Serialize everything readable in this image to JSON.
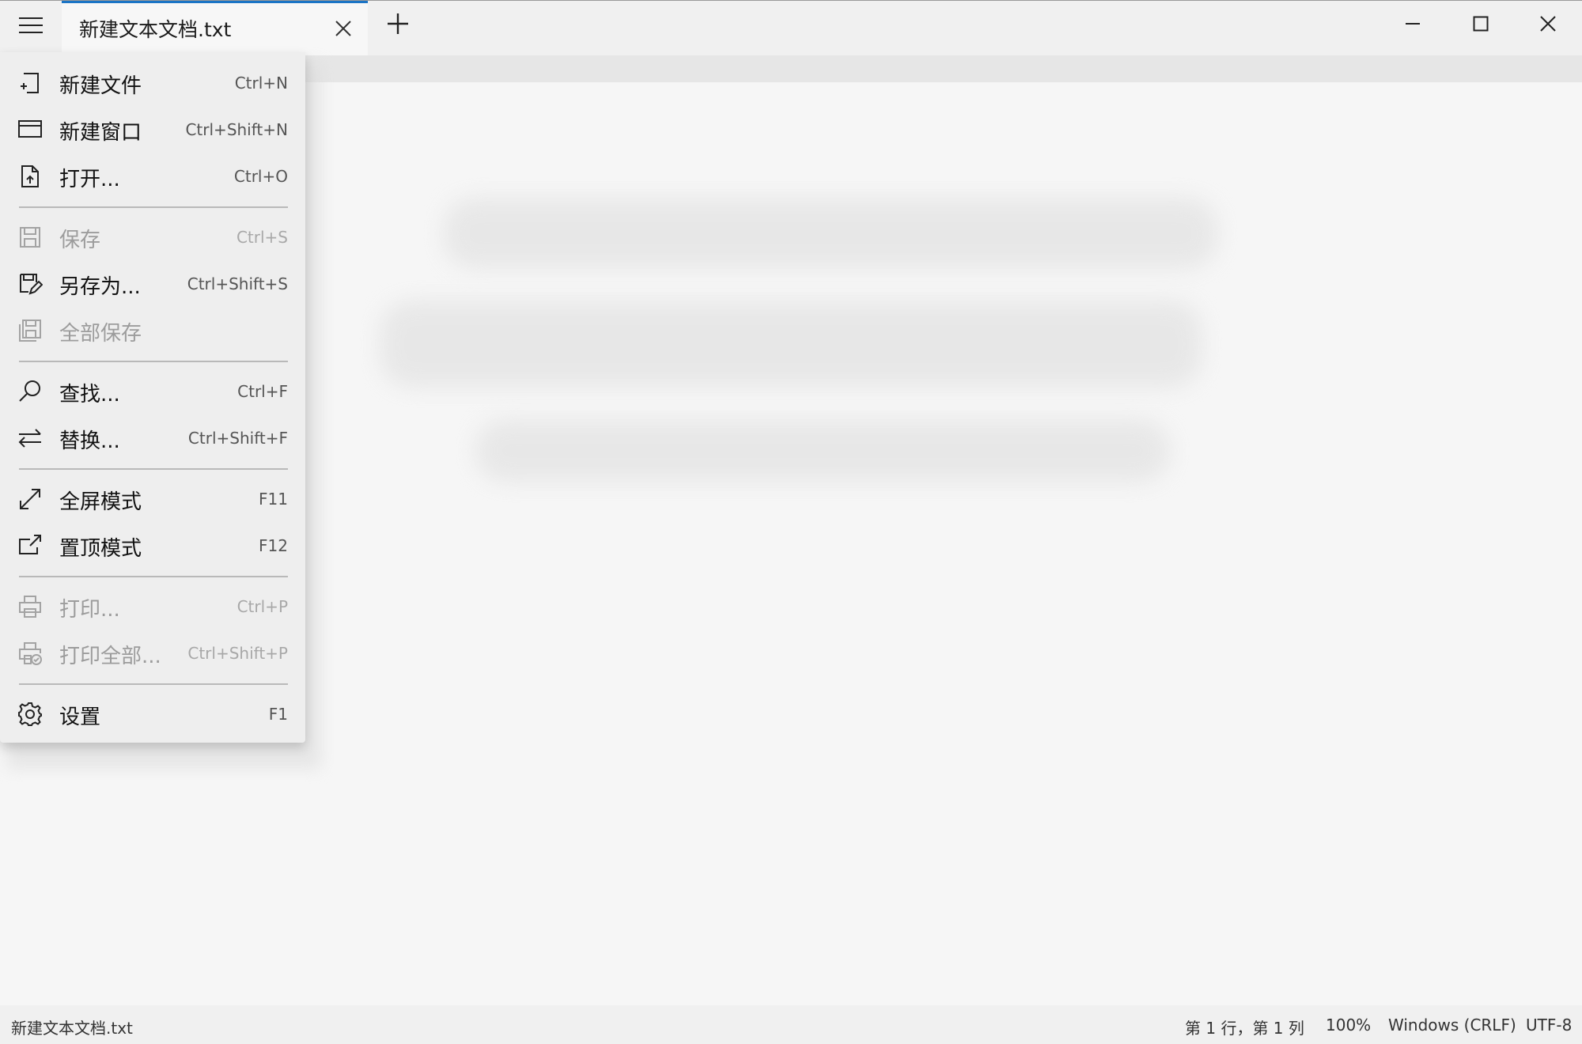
{
  "tab": {
    "title": "新建文本文档.txt"
  },
  "menu": {
    "items": [
      {
        "label": "新建文件",
        "shortcut": "Ctrl+N",
        "icon": "new-file-icon",
        "enabled": true
      },
      {
        "label": "新建窗口",
        "shortcut": "Ctrl+Shift+N",
        "icon": "new-window-icon",
        "enabled": true
      },
      {
        "label": "打开...",
        "shortcut": "Ctrl+O",
        "icon": "open-icon",
        "enabled": true
      },
      {
        "label": "保存",
        "shortcut": "Ctrl+S",
        "icon": "save-icon",
        "enabled": false
      },
      {
        "label": "另存为...",
        "shortcut": "Ctrl+Shift+S",
        "icon": "save-as-icon",
        "enabled": true
      },
      {
        "label": "全部保存",
        "shortcut": "",
        "icon": "save-all-icon",
        "enabled": false
      },
      {
        "label": "查找...",
        "shortcut": "Ctrl+F",
        "icon": "search-icon",
        "enabled": true
      },
      {
        "label": "替换...",
        "shortcut": "Ctrl+Shift+F",
        "icon": "replace-icon",
        "enabled": true
      },
      {
        "label": "全屏模式",
        "shortcut": "F11",
        "icon": "fullscreen-icon",
        "enabled": true
      },
      {
        "label": "置顶模式",
        "shortcut": "F12",
        "icon": "pin-top-icon",
        "enabled": true
      },
      {
        "label": "打印...",
        "shortcut": "Ctrl+P",
        "icon": "print-icon",
        "enabled": false
      },
      {
        "label": "打印全部...",
        "shortcut": "Ctrl+Shift+P",
        "icon": "print-all-icon",
        "enabled": false
      },
      {
        "label": "设置",
        "shortcut": "F1",
        "icon": "gear-icon",
        "enabled": true
      }
    ]
  },
  "status": {
    "filename": "新建文本文档.txt",
    "position": "第 1 行，第 1 列",
    "zoom": "100%",
    "line_ending": "Windows (CRLF)",
    "encoding": "UTF-8"
  },
  "colors": {
    "accent": "#1b74c5",
    "menu_bg": "#eeeeee",
    "disabled_text": "#9c9c9c"
  }
}
